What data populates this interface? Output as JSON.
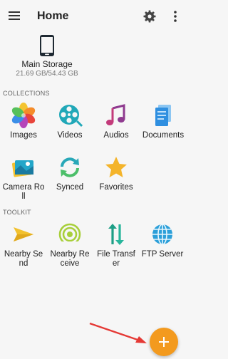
{
  "appbar": {
    "title": "Home",
    "menu_icon": "hamburger-menu-icon",
    "settings_icon": "gear-icon",
    "more_icon": "more-vertical-icon"
  },
  "storage": {
    "name": "Main Storage",
    "size": "21.69 GB/54.43 GB",
    "icon": "smartphone-icon"
  },
  "collections": {
    "header": "COLLECTIONS",
    "items": [
      {
        "label": "Images",
        "icon": "images-flower-icon"
      },
      {
        "label": "Videos",
        "icon": "film-reel-icon"
      },
      {
        "label": "Audios",
        "icon": "music-note-icon"
      },
      {
        "label": "Documents",
        "icon": "document-stack-icon"
      },
      {
        "label": "Camera Roll",
        "icon": "camera-roll-icon"
      },
      {
        "label": "Synced",
        "icon": "sync-icon"
      },
      {
        "label": "Favorites",
        "icon": "star-icon"
      }
    ]
  },
  "toolkit": {
    "header": "TOOLKIT",
    "items": [
      {
        "label": "Nearby Send",
        "icon": "paper-plane-icon"
      },
      {
        "label": "Nearby Receive",
        "icon": "signal-receive-icon"
      },
      {
        "label": "File Transfer",
        "icon": "transfer-arrows-icon"
      },
      {
        "label": "FTP Server",
        "icon": "globe-icon"
      }
    ]
  },
  "fab": {
    "icon": "plus-icon",
    "color": "#f39a1e"
  },
  "annotation": {
    "icon": "red-arrow-icon",
    "color": "#e53935"
  }
}
